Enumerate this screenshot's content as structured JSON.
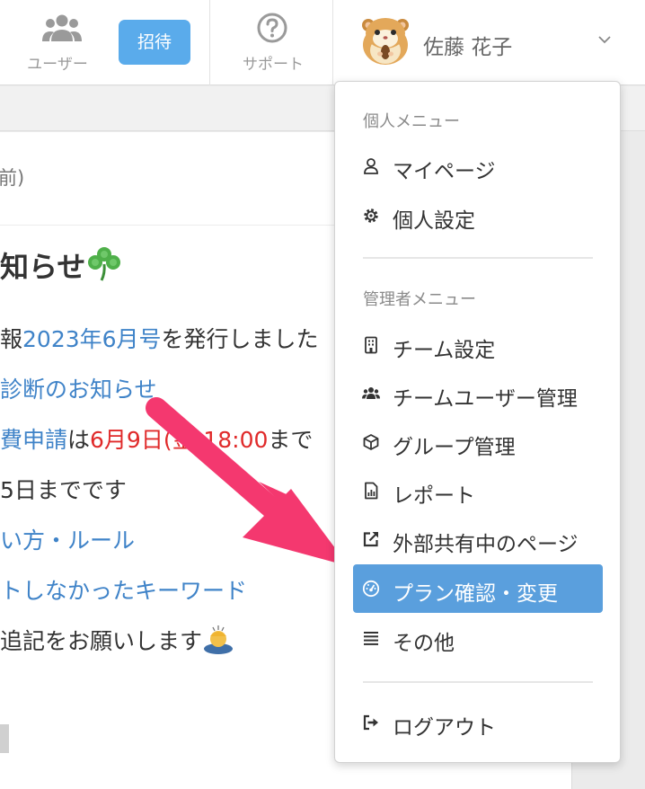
{
  "header": {
    "users_label": "ユーザー",
    "invite_label": "招待",
    "support_label": "サポート",
    "user_name": "佐藤 花子"
  },
  "background": {
    "panel_head_fragment": "前)",
    "notice_title": "知らせ",
    "lines": [
      {
        "parts": [
          {
            "text": "報",
            "style": "plain"
          },
          {
            "text": "2023年6月号",
            "style": "link"
          },
          {
            "text": "を発行しました",
            "style": "plain"
          }
        ]
      },
      {
        "parts": [
          {
            "text": "診断のお知らせ",
            "style": "link"
          }
        ]
      },
      {
        "parts": [
          {
            "text": "費申請",
            "style": "link"
          },
          {
            "text": "は",
            "style": "plain"
          },
          {
            "text": "6月9日(金)18:00",
            "style": "red"
          },
          {
            "text": "まで",
            "style": "plain"
          }
        ]
      },
      {
        "parts": [
          {
            "text": "5日までです",
            "style": "plain"
          }
        ]
      },
      {
        "parts": [
          {
            "text": "い方・ルール",
            "style": "link"
          }
        ]
      },
      {
        "parts": [
          {
            "text": "トしなかったキーワード",
            "style": "link"
          }
        ]
      },
      {
        "parts": [
          {
            "text": "追記をお願いします",
            "style": "plain"
          }
        ]
      }
    ]
  },
  "menu": {
    "personal_header": "個人メニュー",
    "personal_items": [
      {
        "label": "マイページ",
        "icon": "user-icon"
      },
      {
        "label": "個人設定",
        "icon": "gear-icon"
      }
    ],
    "admin_header": "管理者メニュー",
    "admin_items": [
      {
        "label": "チーム設定",
        "icon": "building-icon"
      },
      {
        "label": "チームユーザー管理",
        "icon": "users-icon"
      },
      {
        "label": "グループ管理",
        "icon": "cube-icon"
      },
      {
        "label": "レポート",
        "icon": "report-icon"
      },
      {
        "label": "外部共有中のページ",
        "icon": "external-link-icon"
      },
      {
        "label": "プラン確認・変更",
        "icon": "gauge-icon",
        "active": true
      },
      {
        "label": "その他",
        "icon": "list-icon"
      }
    ],
    "logout_label": "ログアウト"
  },
  "colors": {
    "accent": "#5aabeb",
    "active_item": "#5a9fdd",
    "link": "#3f83c8",
    "deadline_red": "#e02a2a",
    "arrow": "#f4386f"
  }
}
